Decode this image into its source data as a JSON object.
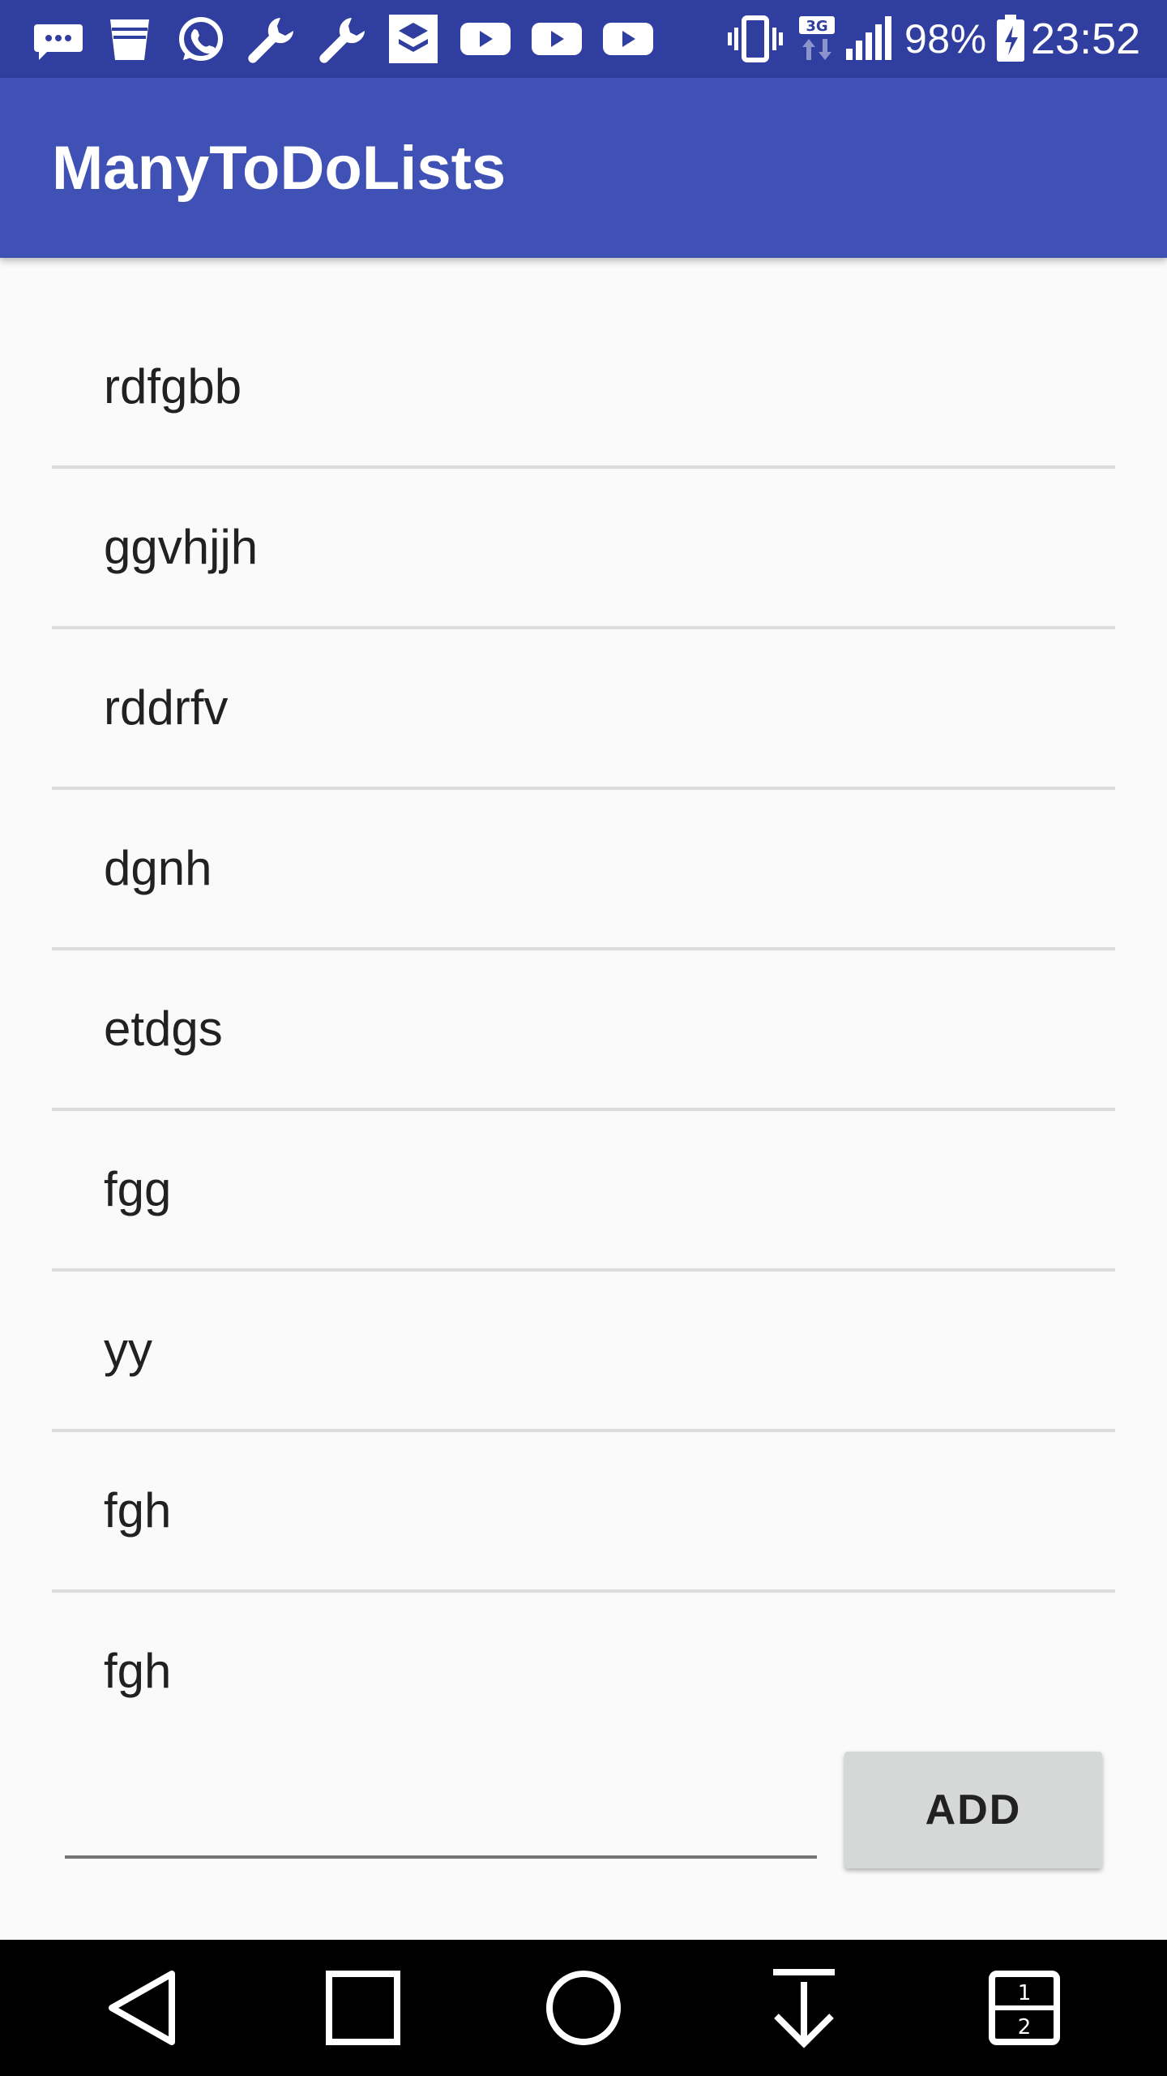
{
  "status_bar": {
    "battery_percent": "98%",
    "time": "23:52",
    "network_type": "3G",
    "icons": [
      "message-icon",
      "cup-icon",
      "whatsapp-icon",
      "wrench-icon",
      "wrench-icon",
      "layers-app-icon",
      "youtube-icon",
      "youtube-icon",
      "youtube-icon",
      "vibrate-icon",
      "network-3g-icon",
      "signal-icon",
      "battery-charging-icon"
    ]
  },
  "app_bar": {
    "title": "ManyToDoLists"
  },
  "todo_list": {
    "items": [
      "rdfgbb",
      "ggvhjjh",
      "rddrfv",
      "dgnh",
      "etdgs",
      "fgg",
      "yy",
      "fgh",
      "fgh"
    ]
  },
  "new_item": {
    "value": "",
    "placeholder": "",
    "add_label": "ADD"
  },
  "nav_bar": {
    "buttons": [
      "back-icon",
      "recents-icon",
      "home-icon",
      "download-icon",
      "split-screen-icon"
    ]
  },
  "colors": {
    "status_bar": "#303f9f",
    "app_bar": "#3f51b5",
    "background": "#fafafa",
    "button": "#d6d7d7"
  }
}
